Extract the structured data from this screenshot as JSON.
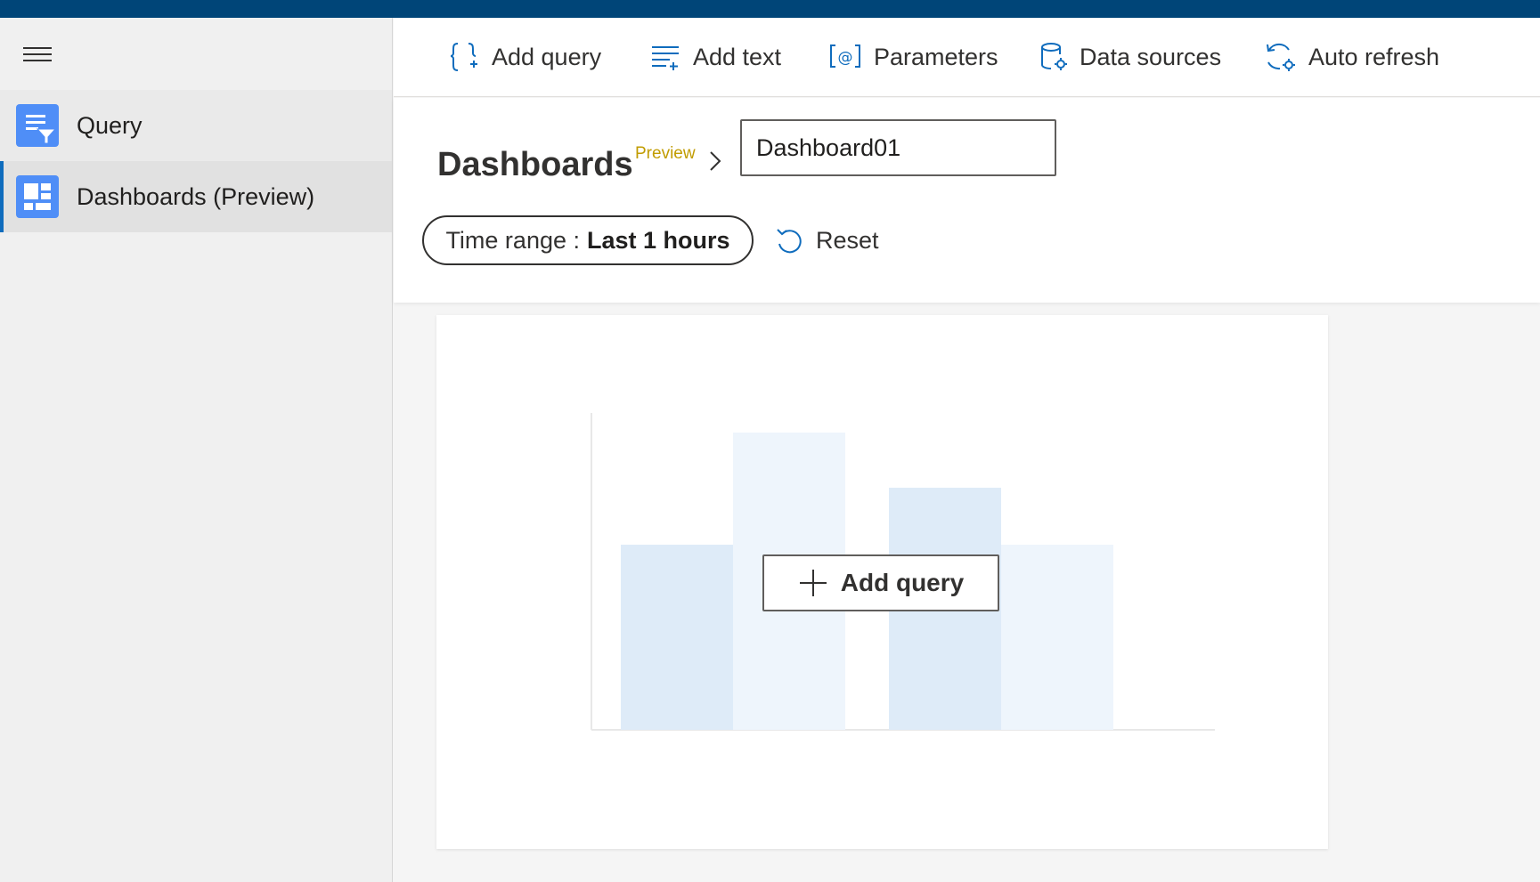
{
  "sidebar": {
    "items": [
      {
        "label": "Query",
        "icon": "query-filter-icon"
      },
      {
        "label": "Dashboards (Preview)",
        "icon": "dashboard-icon",
        "active": true
      }
    ]
  },
  "toolbar": {
    "add_query": "Add query",
    "add_text": "Add text",
    "parameters": "Parameters",
    "data_sources": "Data sources",
    "auto_refresh": "Auto refresh"
  },
  "header": {
    "title": "Dashboards",
    "preview_tag": "Preview",
    "dashboard_name": "Dashboard01"
  },
  "filters": {
    "time_range_label": "Time range :",
    "time_range_value": "Last 1 hours",
    "reset": "Reset"
  },
  "canvas": {
    "add_query": "Add query"
  },
  "colors": {
    "top_bar": "#004578",
    "accent": "#0f6cbd",
    "nav_icon": "#4f8ef7",
    "preview": "#c19c00"
  }
}
